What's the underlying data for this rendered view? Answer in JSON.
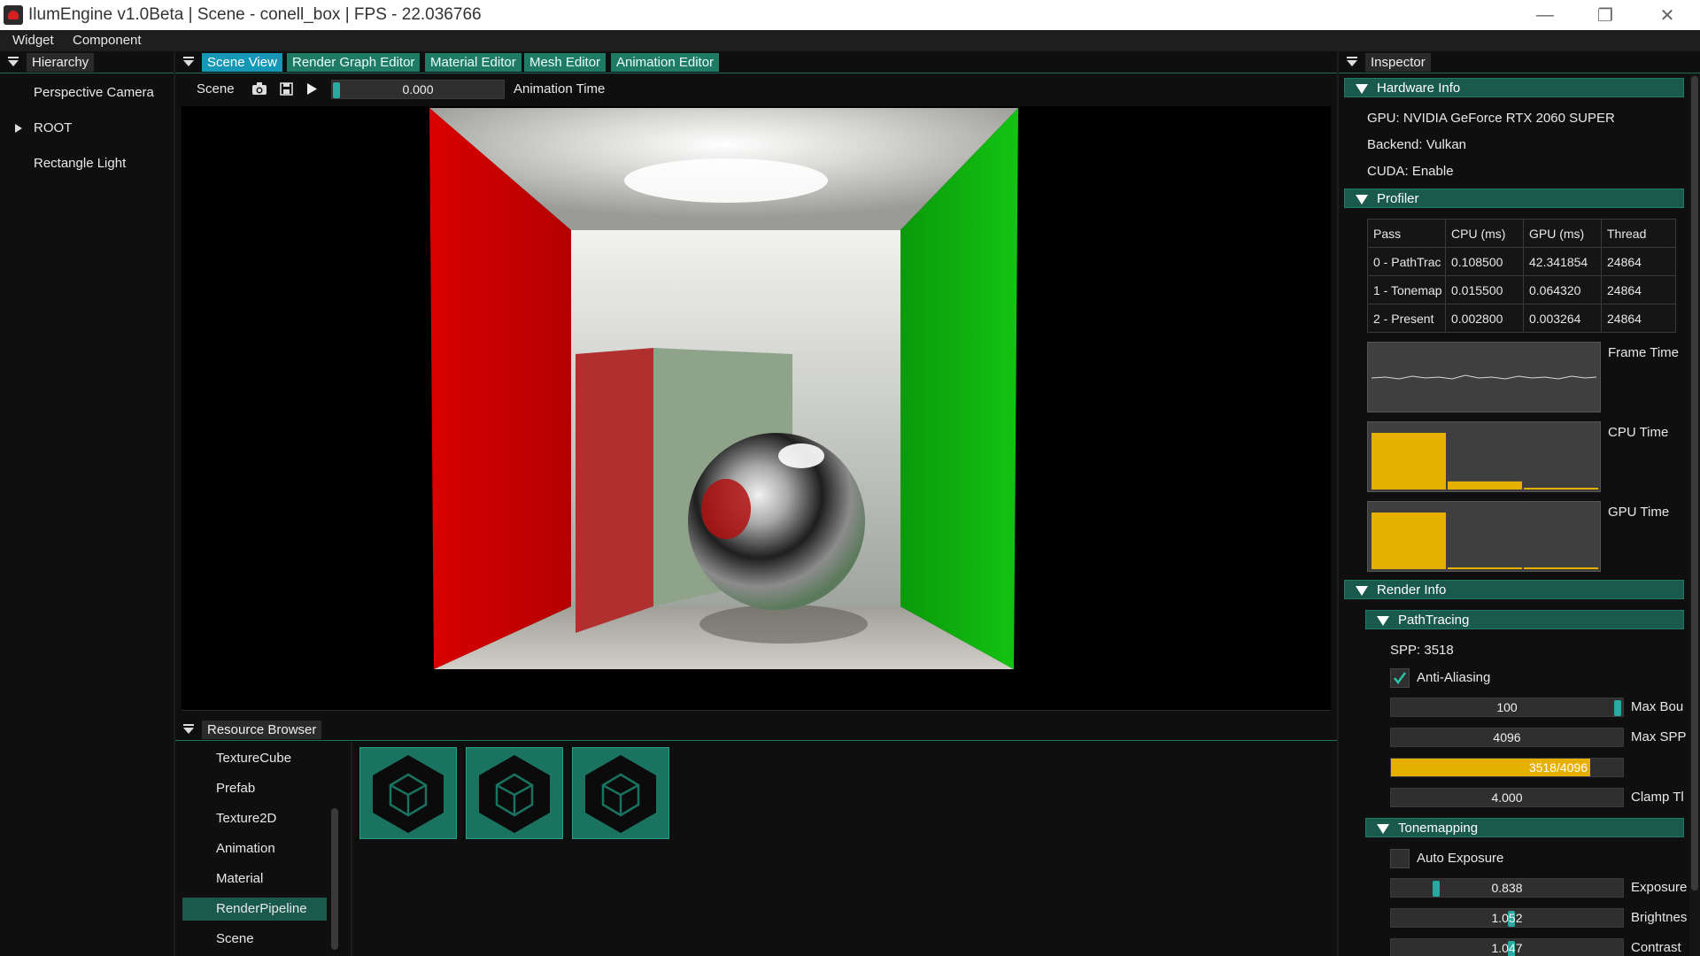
{
  "window": {
    "title": "IlumEngine v1.0Beta | Scene - conell_box | FPS - 22.036766",
    "controls": {
      "minimize": "—",
      "restore": "❐",
      "close": "✕"
    }
  },
  "menubar": [
    "Widget",
    "Component"
  ],
  "hierarchy": {
    "tab": "Hierarchy",
    "items": [
      "Perspective Camera",
      "ROOT",
      "Rectangle Light"
    ]
  },
  "editor_tabs": [
    "Scene View",
    "Render Graph Editor",
    "Material Editor",
    "Mesh Editor",
    "Animation Editor"
  ],
  "scene_toolbar": {
    "label": "Scene",
    "animation_time_value": "0.000",
    "animation_time_label": "Animation Time",
    "icons": [
      "camera-icon",
      "save-icon",
      "play-icon"
    ]
  },
  "resource_browser": {
    "tab": "Resource Browser",
    "categories": [
      "TextureCube",
      "Prefab",
      "Texture2D",
      "Animation",
      "Material",
      "RenderPipeline",
      "Scene"
    ],
    "selected": "RenderPipeline",
    "tiles": [
      "cube-icon",
      "cube-icon",
      "cube-icon"
    ]
  },
  "inspector": {
    "tab": "Inspector",
    "hardware": {
      "header": "Hardware Info",
      "gpu": "GPU: NVIDIA GeForce RTX 2060 SUPER",
      "backend": "Backend: Vulkan",
      "cuda": "CUDA: Enable"
    },
    "profiler": {
      "header": "Profiler",
      "columns": [
        "Pass",
        "CPU (ms)",
        "GPU (ms)",
        "Thread"
      ],
      "rows": [
        [
          "0 - PathTrac",
          "0.108500",
          "42.341854",
          "24864"
        ],
        [
          "1 - Tonemap",
          "0.015500",
          "0.064320",
          "24864"
        ],
        [
          "2 - Present",
          "0.002800",
          "0.003264",
          "24864"
        ]
      ],
      "plots": {
        "frame_time": "Frame Time",
        "cpu_time": "CPU Time",
        "gpu_time": "GPU Time"
      },
      "cpu_bars": [
        0.1085,
        0.0155,
        0.0028
      ],
      "gpu_bars": [
        42.341854,
        0.06432,
        0.003264
      ]
    },
    "render_info": {
      "header": "Render Info",
      "pathtracing": {
        "header": "PathTracing",
        "spp": "SPP: 3518",
        "anti_aliasing": "Anti-Aliasing",
        "anti_aliasing_checked": true,
        "max_bounce_value": "100",
        "max_bounce_label": "Max Bou",
        "max_bounce_fraction": 1.0,
        "max_spp_value": "4096",
        "max_spp_label": "Max SPP",
        "progress_text": "3518/4096",
        "progress_fraction": 0.859,
        "clamp_value": "4.000",
        "clamp_label": "Clamp Tl"
      },
      "tonemapping": {
        "header": "Tonemapping",
        "auto_exposure": "Auto Exposure",
        "auto_exposure_checked": false,
        "exposure_value": "0.838",
        "exposure_label": "Exposure",
        "exposure_fraction": 0.18,
        "brightness_value": "1.052",
        "brightness_label": "Brightnes",
        "brightness_fraction": 0.52,
        "contrast_value": "1.047",
        "contrast_label": "Contrast",
        "contrast_fraction": 0.52
      }
    }
  },
  "colors": {
    "accent_green": "#1f7a66",
    "active_tab": "#1598b8",
    "plot_bar": "#e6b000",
    "slider_grab": "#27a9a4"
  }
}
